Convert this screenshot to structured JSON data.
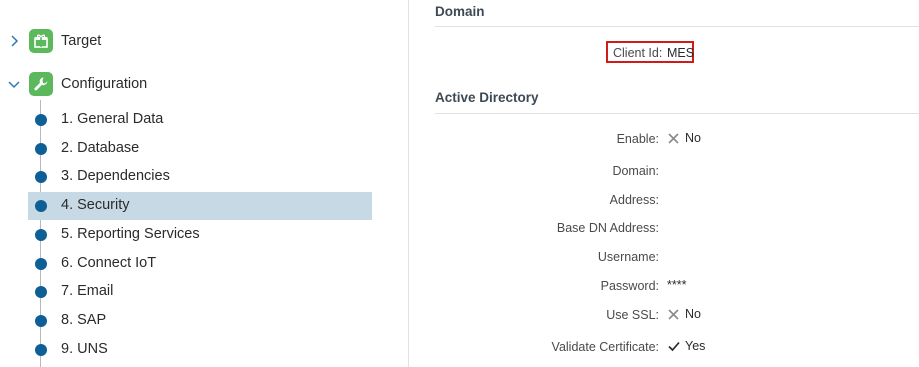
{
  "tree": {
    "target": {
      "label": "Target",
      "icon": "gift-icon",
      "expanded": false,
      "color": "#5cb85c"
    },
    "configuration": {
      "label": "Configuration",
      "icon": "wrench-icon",
      "expanded": true,
      "color": "#5cb85c"
    },
    "steps": [
      {
        "label": "1. General Data"
      },
      {
        "label": "2. Database"
      },
      {
        "label": "3. Dependencies"
      },
      {
        "label": "4. Security",
        "selected": true
      },
      {
        "label": "5. Reporting Services"
      },
      {
        "label": "6. Connect IoT"
      },
      {
        "label": "7. Email"
      },
      {
        "label": "8. SAP"
      },
      {
        "label": "9. UNS"
      }
    ]
  },
  "domain_section": {
    "title": "Domain",
    "client_id": {
      "label": "Client Id:",
      "value": "MES"
    }
  },
  "active_directory": {
    "title": "Active Directory",
    "enable": {
      "label": "Enable:",
      "value": "No",
      "icon": "cross-icon"
    },
    "domain": {
      "label": "Domain:",
      "value": ""
    },
    "address": {
      "label": "Address:",
      "value": ""
    },
    "base_dn": {
      "label": "Base DN Address:",
      "value": ""
    },
    "username": {
      "label": "Username:",
      "value": ""
    },
    "password": {
      "label": "Password:",
      "value": "****"
    },
    "use_ssl": {
      "label": "Use SSL:",
      "value": "No",
      "icon": "cross-icon"
    },
    "validate_certificate": {
      "label": "Validate Certificate:",
      "value": "Yes",
      "icon": "check-icon"
    }
  },
  "colors": {
    "accent_green": "#5cb85c",
    "step_dot": "#0f5f97",
    "selected_row": "#c6d9e4",
    "highlight_border": "#d11b1b"
  }
}
